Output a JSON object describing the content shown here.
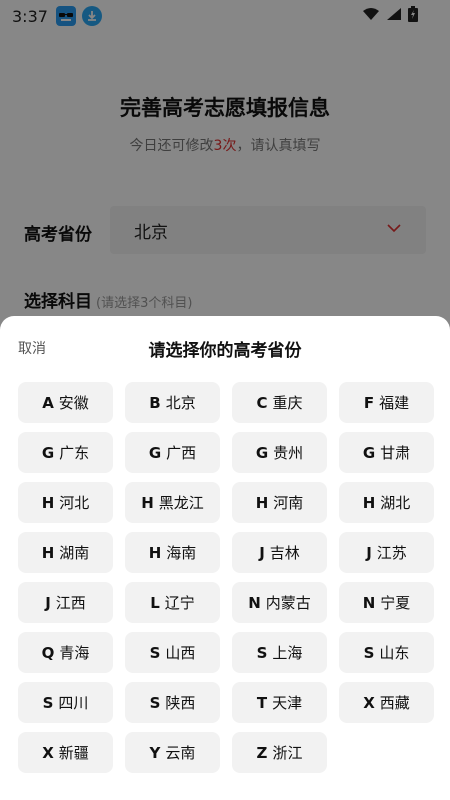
{
  "status_bar": {
    "time": "3:37"
  },
  "page": {
    "title": "完善高考志愿填报信息",
    "subtitle_prefix": "今日还可修改",
    "subtitle_count": "3次",
    "subtitle_suffix": "，请认真填写",
    "province_label": "高考省份",
    "province_value": "北京",
    "subject_label": "选择科目",
    "subject_hint": "(请选择3个科目)"
  },
  "sheet": {
    "cancel_label": "取消",
    "title": "请选择你的高考省份",
    "provinces": [
      {
        "letter": "A",
        "name": "安徽"
      },
      {
        "letter": "B",
        "name": "北京"
      },
      {
        "letter": "C",
        "name": "重庆"
      },
      {
        "letter": "F",
        "name": "福建"
      },
      {
        "letter": "G",
        "name": "广东"
      },
      {
        "letter": "G",
        "name": "广西"
      },
      {
        "letter": "G",
        "name": "贵州"
      },
      {
        "letter": "G",
        "name": "甘肃"
      },
      {
        "letter": "H",
        "name": "河北"
      },
      {
        "letter": "H",
        "name": "黑龙江"
      },
      {
        "letter": "H",
        "name": "河南"
      },
      {
        "letter": "H",
        "name": "湖北"
      },
      {
        "letter": "H",
        "name": "湖南"
      },
      {
        "letter": "H",
        "name": "海南"
      },
      {
        "letter": "J",
        "name": "吉林"
      },
      {
        "letter": "J",
        "name": "江苏"
      },
      {
        "letter": "J",
        "name": "江西"
      },
      {
        "letter": "L",
        "name": "辽宁"
      },
      {
        "letter": "N",
        "name": "内蒙古"
      },
      {
        "letter": "N",
        "name": "宁夏"
      },
      {
        "letter": "Q",
        "name": "青海"
      },
      {
        "letter": "S",
        "name": "山西"
      },
      {
        "letter": "S",
        "name": "上海"
      },
      {
        "letter": "S",
        "name": "山东"
      },
      {
        "letter": "S",
        "name": "四川"
      },
      {
        "letter": "S",
        "name": "陕西"
      },
      {
        "letter": "T",
        "name": "天津"
      },
      {
        "letter": "X",
        "name": "西藏"
      },
      {
        "letter": "X",
        "name": "新疆"
      },
      {
        "letter": "Y",
        "name": "云南"
      },
      {
        "letter": "Z",
        "name": "浙江"
      }
    ]
  },
  "colors": {
    "accent": "#e03030",
    "button_bg": "#f2f2f2",
    "app_icon_1": "#2a9df4",
    "app_icon_2": "#2aa8f5"
  },
  "icons": [
    "app-icon-glasses",
    "download-icon",
    "wifi-icon",
    "signal-icon",
    "battery-icon",
    "chevron-down-icon"
  ]
}
